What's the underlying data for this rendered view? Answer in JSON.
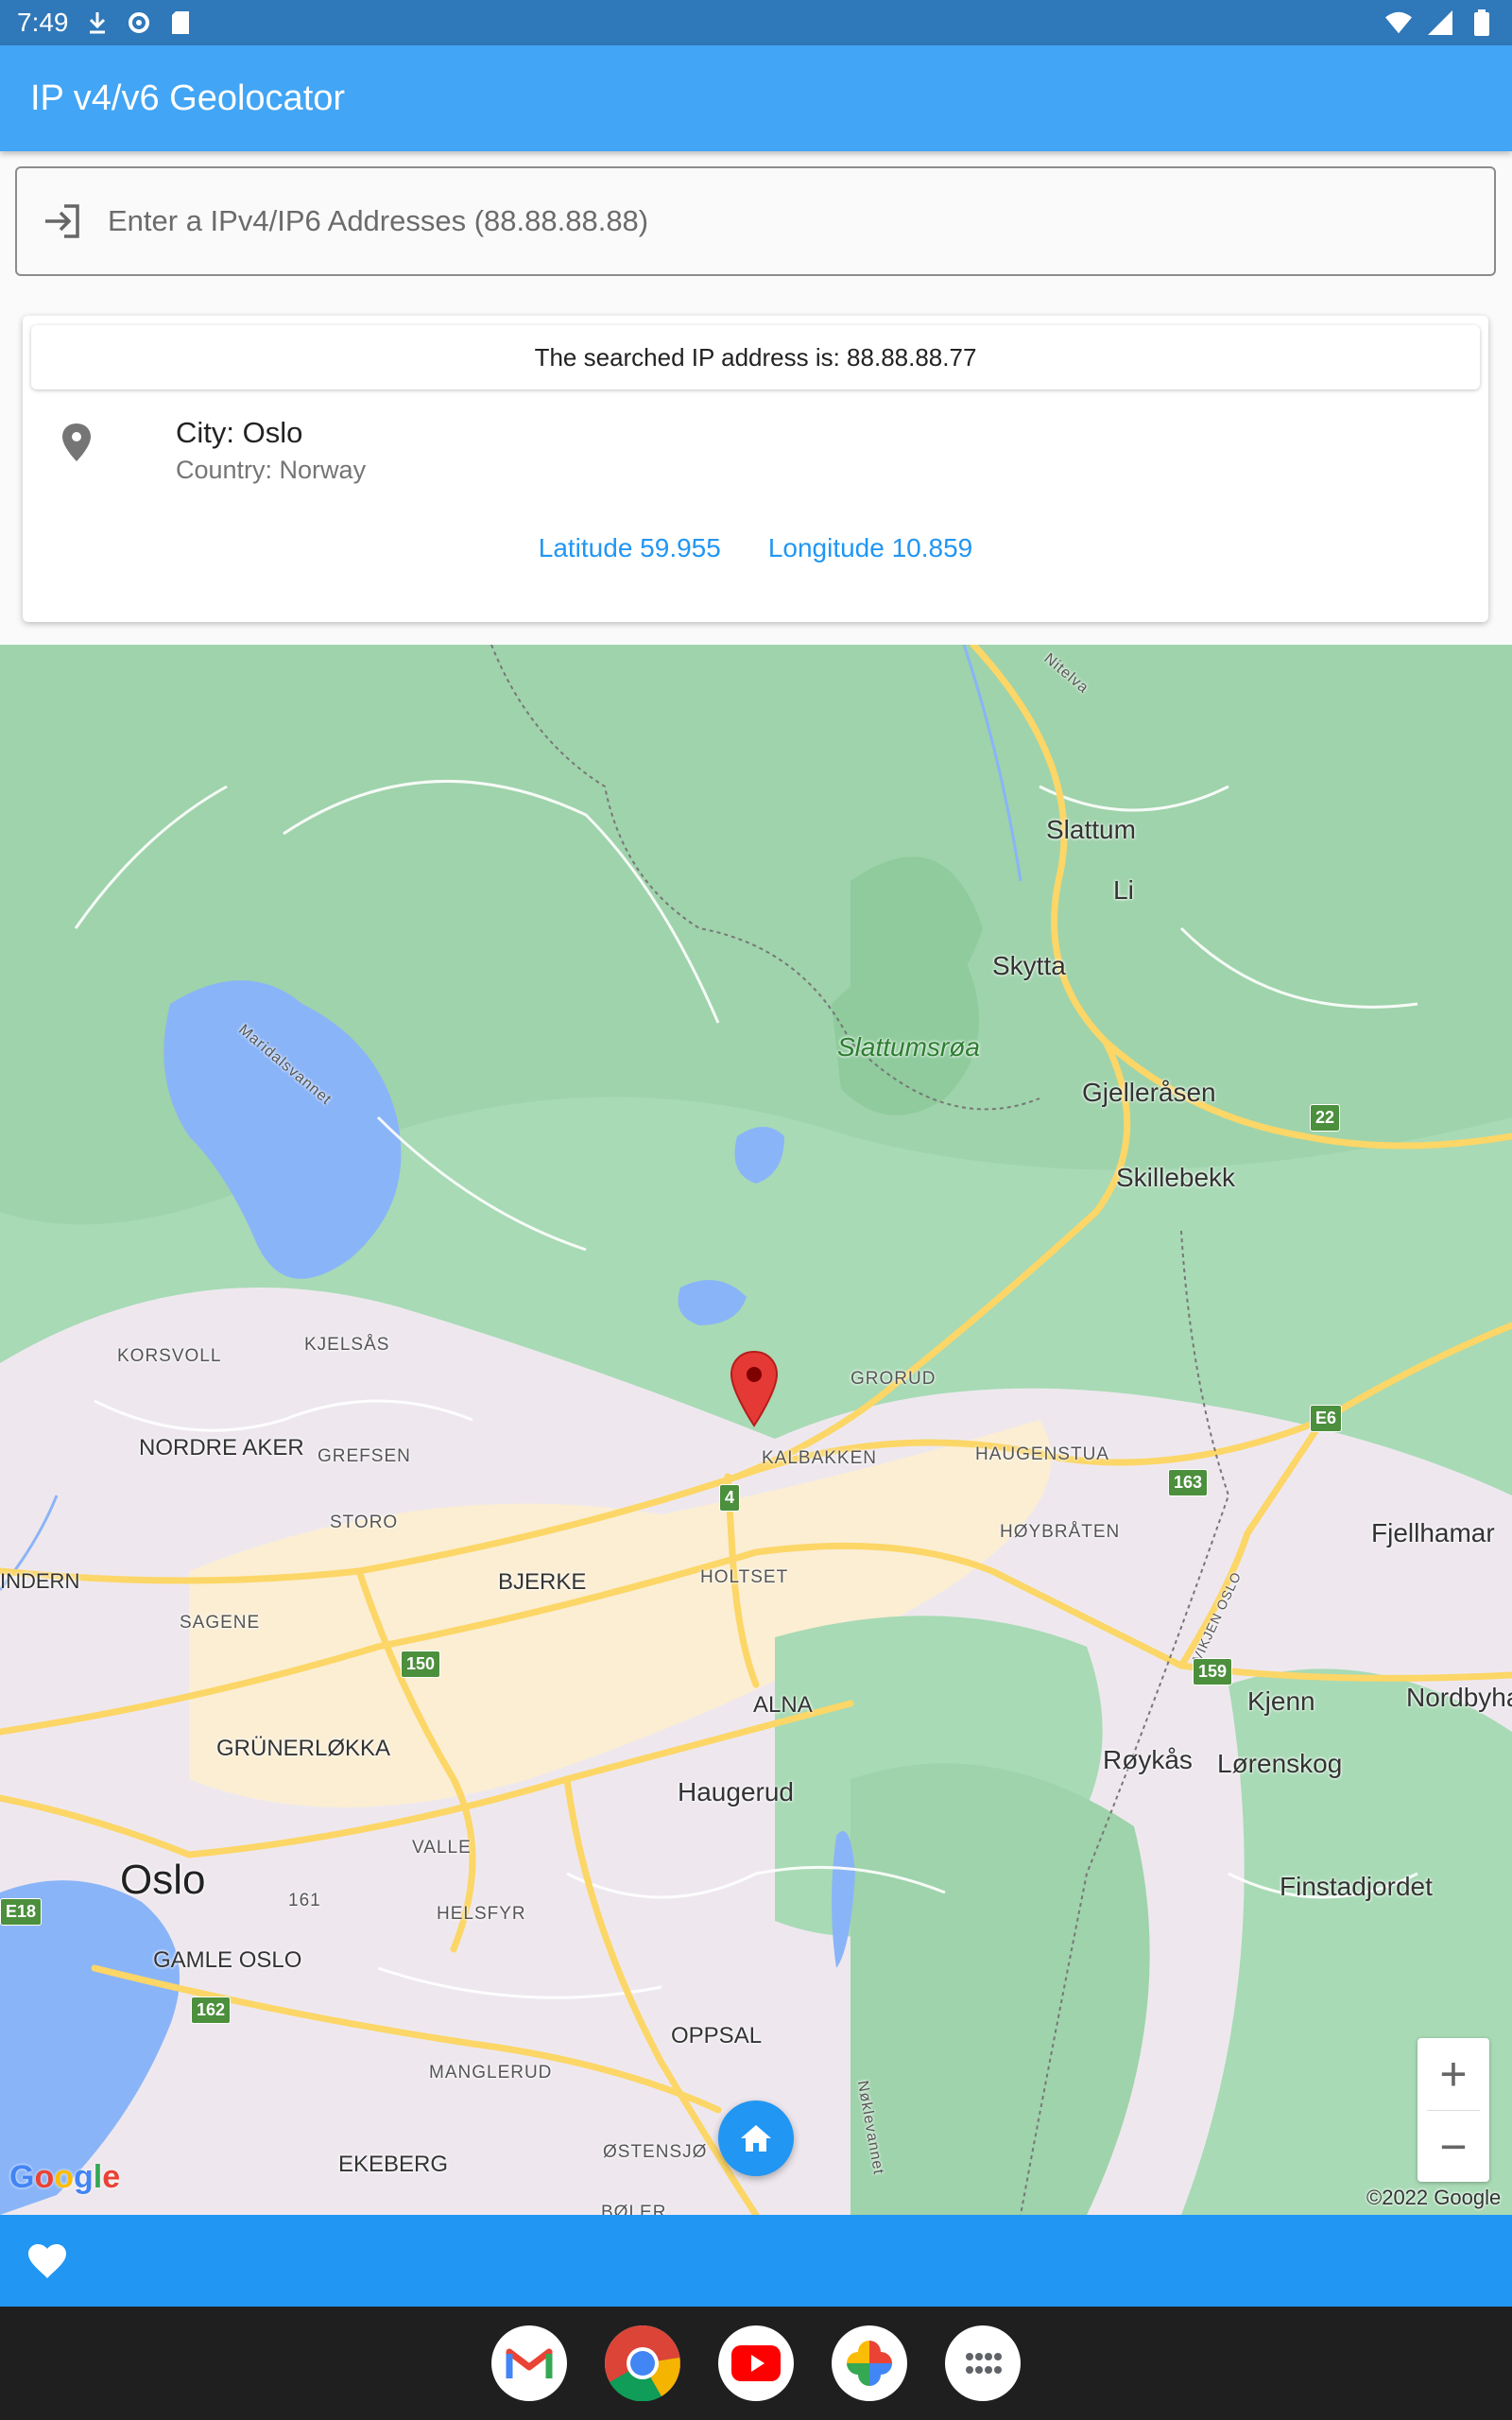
{
  "status_bar": {
    "time": "7:49"
  },
  "app_bar": {
    "title": "IP v4/v6 Geolocator"
  },
  "search": {
    "placeholder": "Enter a IPv4/IP6 Addresses (88.88.88.88)",
    "value": ""
  },
  "result": {
    "searched_text": "The searched IP address is: 88.88.88.77",
    "city": "City: Oslo",
    "country": "Country: Norway",
    "latitude": "Latitude 59.955",
    "longitude": "Longitude 10.859"
  },
  "map": {
    "labels": {
      "slattum": "Slattum",
      "li": "Li",
      "skytta": "Skytta",
      "slattumsroa": "Slattumsrøa",
      "gjellerasen": "Gjelleråsen",
      "skillebekk": "Skillebekk",
      "korsvoll": "KORSVOLL",
      "kjelsas": "KJELSÅS",
      "grorud": "GRORUD",
      "nordre_aker": "NORDRE AKER",
      "grefsen": "GREFSEN",
      "kalbakken": "KALBAKKEN",
      "haugenstua": "HAUGENSTUA",
      "storo": "STORO",
      "hoybraten": "HØYBRÅTEN",
      "fjellhamar": "Fjellhamar",
      "indern": "INDERN",
      "bjerke": "BJERKE",
      "holtset": "HOLTSET",
      "sagene": "SAGENE",
      "alna": "ALNA",
      "kjenn": "Kjenn",
      "nordbyhagen": "Nordbyha",
      "grunerlokka": "GRÜNERLØKKA",
      "royka": "Røykås",
      "lorenskog": "Lørenskog",
      "haugerud": "Haugerud",
      "valle": "VALLE",
      "oslo": "Oslo",
      "finstadjordet": "Finstadjordet",
      "helsfyr": "HELSFYR",
      "gamle_oslo": "GAMLE OSLO",
      "oppsal": "OPPSAL",
      "manglerud": "MANGLERUD",
      "ekeberg": "EKEBERG",
      "ostensjo": "ØSTENSJØ",
      "bøler": "BØLER",
      "maridalsvannet": "Maridalsvannet",
      "nitelva": "Nitelva",
      "noklevannet": "Nøklevannet",
      "vikjen_oslo": "VIKJEN OSLO",
      "num161": "161"
    },
    "shields": {
      "r22": "22",
      "e6": "E6",
      "r4": "4",
      "r163": "163",
      "r150": "150",
      "r159": "159",
      "e18": "E18",
      "r162": "162"
    },
    "zoom_in": "+",
    "zoom_out": "−",
    "google_logo": {
      "G": "G",
      "o1": "o",
      "o2": "o",
      "g": "g",
      "l": "l",
      "e": "e"
    },
    "copyright": "©2022 Google"
  },
  "colors": {
    "appbar": "#42a5f5",
    "statusbar": "#2f78b9",
    "accent": "#2196f3",
    "marker": "#e53935"
  }
}
